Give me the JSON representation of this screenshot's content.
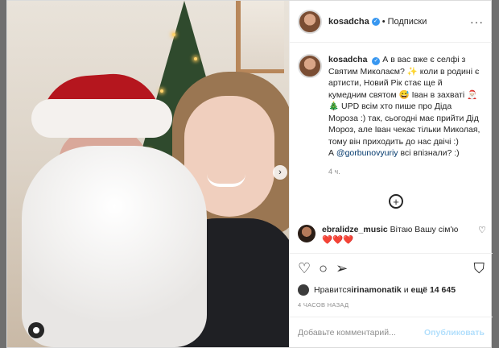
{
  "post": {
    "username": "kosadcha",
    "follow_label": "Подписки",
    "caption": "А в вас вже є селфі з Святим Миколаєм? ✨ коли в родині є артисти, Новий Рік стає ще й кумедним святом 😅 Іван в захваті 🎅🏻🎄 UPD всім хто пише про Діда Мороза :) так, сьогодні має прийти Дід Мороз, але Іван чекає тільки Миколая, тому він приходить до нас двічі :)",
    "caption_tail_prefix": "А ",
    "caption_mention": "@gorbunovyuriy",
    "caption_tail_suffix": " всі впізнали? :)",
    "time": "4 ч."
  },
  "comment": {
    "username": "ebralidze_music",
    "text": "Вітаю Вашу сім'ю",
    "emoji": "❤️❤️❤️"
  },
  "likes": {
    "prefix": "Нравится ",
    "user": "irinamonatik",
    "middle": " и ",
    "count": "ещё 14 645"
  },
  "timestamp": "4 ЧАСОВ НАЗАД",
  "composer": {
    "placeholder": "Добавьте комментарий...",
    "publish_label": "Опубликовать"
  },
  "icons": {
    "more": "more-icon",
    "verified": "verified-badge-icon",
    "next": "chevron-right-icon",
    "tag": "person-tag-icon",
    "add": "plus-circle-icon",
    "like": "heart-icon",
    "comment": "comment-icon",
    "share": "share-icon",
    "save": "bookmark-icon"
  }
}
